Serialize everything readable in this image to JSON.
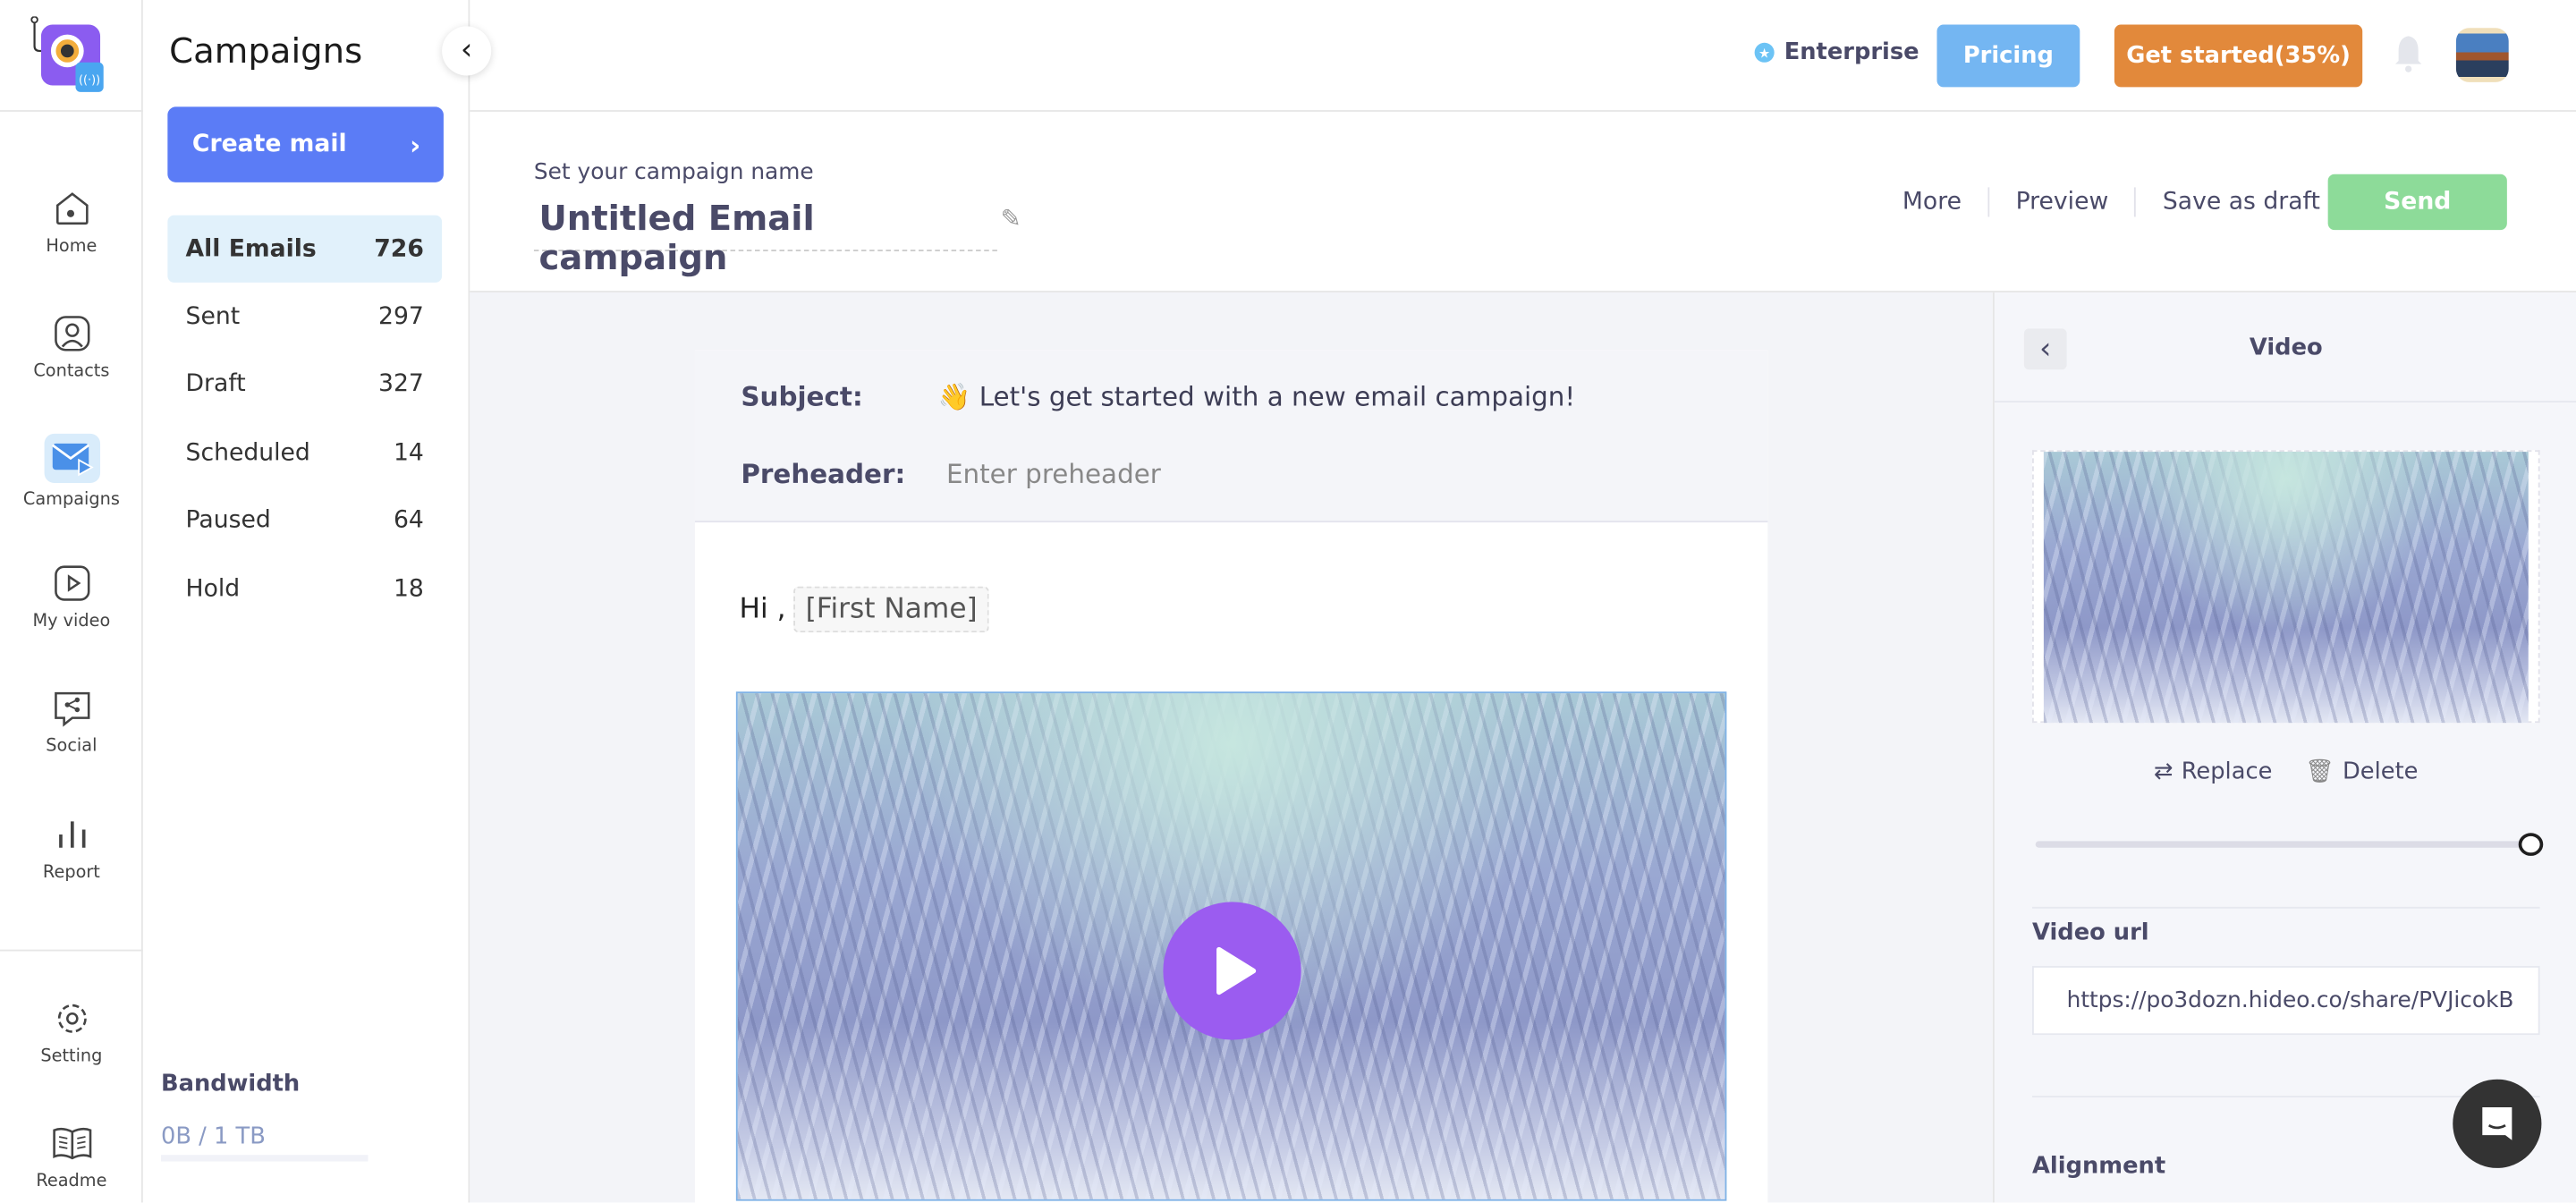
{
  "nav": {
    "items": [
      {
        "label": "Home",
        "icon": "home-icon"
      },
      {
        "label": "Contacts",
        "icon": "contacts-icon"
      },
      {
        "label": "Campaigns",
        "icon": "campaigns-icon",
        "active": true
      },
      {
        "label": "My video",
        "icon": "video-icon"
      },
      {
        "label": "Social",
        "icon": "social-icon"
      },
      {
        "label": "Report",
        "icon": "report-icon"
      }
    ],
    "bottom": [
      {
        "label": "Setting",
        "icon": "gear-icon"
      },
      {
        "label": "Readme",
        "icon": "book-icon"
      }
    ]
  },
  "panel": {
    "title": "Campaigns",
    "create_label": "Create mail",
    "folders": [
      {
        "label": "All Emails",
        "count": "726",
        "active": true
      },
      {
        "label": "Sent",
        "count": "297"
      },
      {
        "label": "Draft",
        "count": "327"
      },
      {
        "label": "Scheduled",
        "count": "14"
      },
      {
        "label": "Paused",
        "count": "64"
      },
      {
        "label": "Hold",
        "count": "18"
      }
    ],
    "bandwidth": {
      "label": "Bandwidth",
      "value": "0B / 1 TB",
      "used_fraction": 0
    }
  },
  "topbar": {
    "plan": "Enterprise",
    "pricing": "Pricing",
    "get_started": "Get started(35%)",
    "colors": {
      "pricing": "#74b6f2",
      "get_started": "#e2893b"
    }
  },
  "campaign": {
    "name_label": "Set your campaign name",
    "name": "Untitled Email campaign",
    "more": "More",
    "preview": "Preview",
    "save_draft": "Save as draft",
    "send": "Send",
    "send_color": "#8ddb99"
  },
  "email": {
    "subject_label": "Subject:",
    "subject": "👋 Let's get started with a new email campaign!",
    "preheader_label": "Preheader:",
    "preheader_placeholder": "Enter preheader",
    "greeting": "Hi ,",
    "merge_tag": "[First Name]",
    "play_color": "#9b5cf0"
  },
  "video_panel": {
    "title": "Video",
    "replace": "Replace",
    "delete": "Delete",
    "slider_value": 100,
    "url_label": "Video url",
    "url": "https://po3dozn.hideo.co/share/PVJicokB",
    "alignment_label": "Alignment"
  }
}
